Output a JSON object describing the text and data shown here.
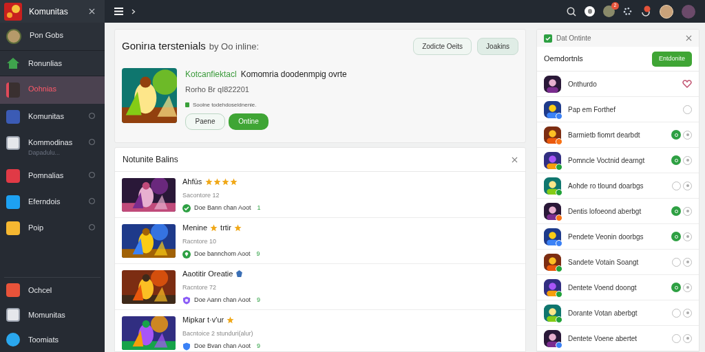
{
  "sidebar": {
    "title": "Komunitas",
    "items": [
      {
        "label": "Pon Gobs",
        "kind": "avatar",
        "selected": false,
        "indicator": false
      },
      {
        "label": "Ronunlias",
        "kind": "home",
        "selected": false,
        "indicator": false
      },
      {
        "label": "Oohnias",
        "selected": true,
        "indicator": false
      },
      {
        "label": "Komunitas",
        "kind": "blue",
        "selected": false,
        "indicator": true
      },
      {
        "label": "Kommodinas",
        "sublabel": "Dapadulu...",
        "kind": "doc",
        "selected": false,
        "indicator": true
      },
      {
        "label": "Pomnalias",
        "kind": "red",
        "selected": false,
        "indicator": true
      },
      {
        "label": "Eferndois",
        "kind": "sky",
        "selected": false,
        "indicator": true
      },
      {
        "label": "Poip",
        "kind": "folder",
        "selected": false,
        "indicator": true
      }
    ],
    "bottom_items": [
      {
        "label": "Ochcel",
        "kind": "orange"
      },
      {
        "label": "Momunitas",
        "kind": "doc"
      },
      {
        "label": "Toomiats",
        "kind": "circle"
      }
    ]
  },
  "topbar": {
    "notification_count": "2"
  },
  "featured": {
    "title": "Gonirıa terstenials",
    "subtitle": "by Oo inline:",
    "buttons": [
      {
        "label": "Zodicte Oeits"
      },
      {
        "label": "Joakins"
      }
    ],
    "game": {
      "highlight": "Kotcanfiektacl",
      "title": "Komomria doodenmpig ovrte",
      "meta": "Rorho Br qI822201",
      "status": "Soolne todehdoseidnenie.",
      "actions": [
        {
          "label": "Paene",
          "kind": "outline"
        },
        {
          "label": "Ontine",
          "kind": "primary"
        }
      ]
    }
  },
  "list": {
    "title": "Notunite Balins",
    "rows": [
      {
        "title": [
          {
            "kind": "text",
            "text": "Ahfüs"
          },
          {
            "kind": "stars",
            "stars": 4
          }
        ],
        "meta": "Sacontore 12",
        "status": {
          "kind": "check",
          "text": "Doe Bann chan Aoot"
        },
        "count": "1"
      },
      {
        "title": [
          {
            "kind": "text",
            "text": "Menine"
          },
          {
            "kind": "star"
          },
          {
            "kind": "text",
            "text": "trtir"
          },
          {
            "kind": "star"
          }
        ],
        "meta": "Racntore 10",
        "status": {
          "kind": "gem",
          "text": "Doe bannchom Aoot"
        },
        "count": "9"
      },
      {
        "title": [
          {
            "kind": "text",
            "text": "Aaotitir Oreatie"
          },
          {
            "kind": "badge"
          }
        ],
        "meta": "Racntore 72",
        "status": {
          "kind": "shield",
          "text": "Doe Aann chan Aoot"
        },
        "count": "9"
      },
      {
        "title": [
          {
            "kind": "text",
            "text": "Mipkar t·v'ur"
          },
          {
            "kind": "star"
          }
        ],
        "meta": "Bacntoice 2 stunduri(alur)",
        "status": {
          "kind": "badge",
          "text": "Doe Bvan chan Aoot"
        },
        "count": "9"
      }
    ]
  },
  "friends": {
    "header": {
      "label": "Dat Ontinte",
      "checked": true
    },
    "section": "Oemdortnls",
    "section_button": "Entdonite",
    "items": [
      {
        "name": "Onthurdo",
        "kind": "heart"
      },
      {
        "name": "Pap em Forthef",
        "kind": "plain",
        "color": "#3b82f6"
      },
      {
        "name": "Barmietb fiomrt dearbdt",
        "kind": "pair",
        "online": true,
        "color": "#f97316"
      },
      {
        "name": "Pomncle Voctnid dearngt",
        "kind": "pair",
        "online": true,
        "color": "#22a33a"
      },
      {
        "name": "Aohde ro tlound doarbgs",
        "kind": "pair",
        "online": false,
        "color": "#22a33a"
      },
      {
        "name": "Dentis lofoeond aberbgt",
        "kind": "pair",
        "online": true,
        "color": "#f97316"
      },
      {
        "name": "Pendete Veonin doorbgs",
        "kind": "pair",
        "online": true,
        "color": "#3b82f6"
      },
      {
        "name": "Sandete Votain Soangt",
        "kind": "pair",
        "online": false,
        "color": "#22a33a"
      },
      {
        "name": "Dentete Voend doongt",
        "kind": "pair",
        "online": true,
        "color": "#22a33a"
      },
      {
        "name": "Dorante Votan aberbgt",
        "kind": "pair",
        "online": false,
        "color": "#22a33a"
      },
      {
        "name": "Dentete Voene abertet",
        "kind": "pair",
        "online": false,
        "color": "#3b82f6"
      }
    ]
  }
}
